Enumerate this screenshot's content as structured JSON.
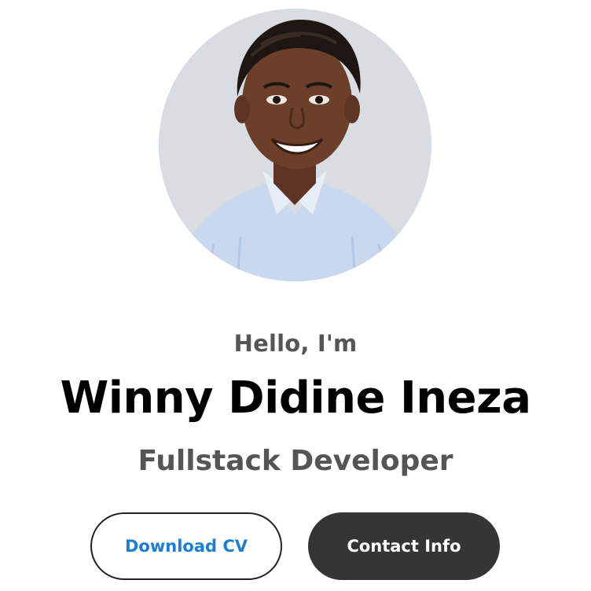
{
  "hero": {
    "greeting": "Hello, I'm",
    "name": "Winny Didine Ineza",
    "role": "Fullstack Developer"
  },
  "profile_image": {
    "background": "#d9dde2",
    "shirt_color": "#c9d8ee",
    "skin_color": "#6b3f2a",
    "hair_color": "#1e1612"
  },
  "buttons": {
    "download_cv": "Download CV",
    "contact_info": "Contact Info"
  },
  "colors": {
    "accent_link": "#1a7fd4",
    "dark_button": "#353535",
    "heading": "#000000",
    "subtext": "#555555"
  }
}
